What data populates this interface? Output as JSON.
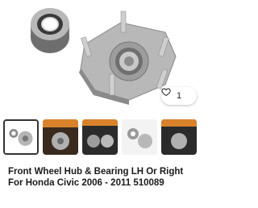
{
  "product": {
    "title": "Front Wheel Hub & Bearing LH Or Right For Honda Civic 2006 - 2011 510089",
    "image_description_icon": "wheel-hub-image"
  },
  "like": {
    "count": "1",
    "icon": "heart-outline-icon"
  },
  "thumbnails": [
    {
      "name": "thumb-1",
      "selected": true,
      "label": ""
    },
    {
      "name": "thumb-2",
      "selected": false,
      "label": ""
    },
    {
      "name": "thumb-3",
      "selected": false,
      "label": ""
    },
    {
      "name": "thumb-4",
      "selected": false,
      "label": ""
    },
    {
      "name": "thumb-5",
      "selected": false,
      "label": ""
    }
  ],
  "colors": {
    "accent_orange": "#d9822b",
    "dark_thumb_bg": "#2b2b2b"
  }
}
